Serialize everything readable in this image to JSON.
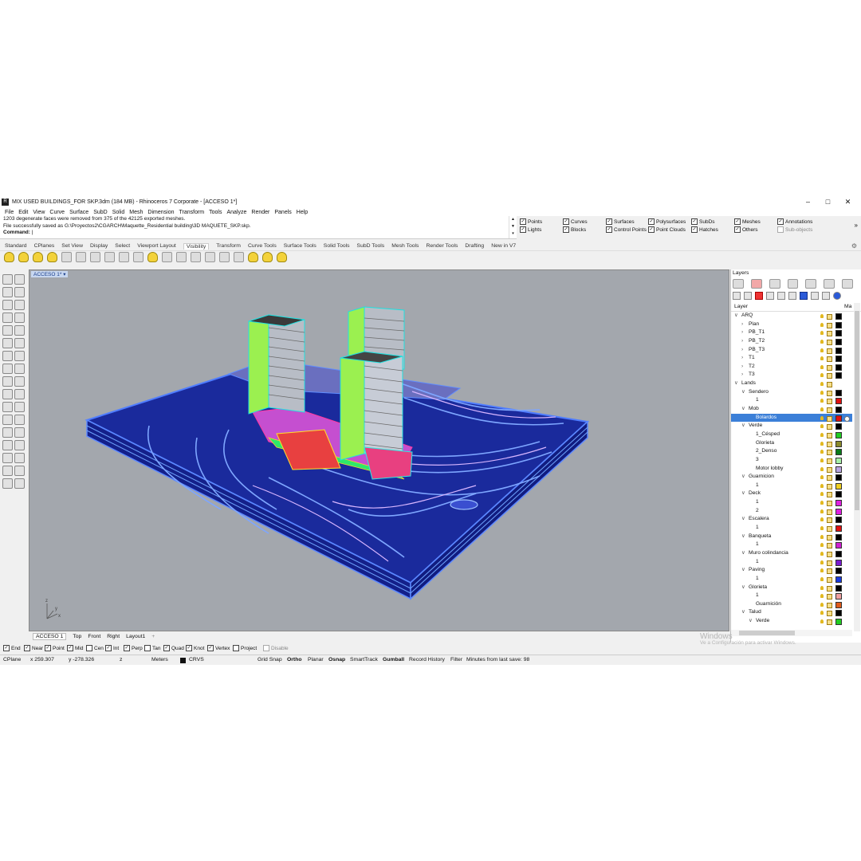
{
  "window": {
    "title": "MIX USED BUILDINGS_FOR SKP.3dm (184 MB) - Rhinoceros 7 Corporate - [ACCESO 1*]",
    "controls": [
      "–",
      "□",
      "✕"
    ]
  },
  "menu": [
    "File",
    "Edit",
    "View",
    "Curve",
    "Surface",
    "SubD",
    "Solid",
    "Mesh",
    "Dimension",
    "Transform",
    "Tools",
    "Analyze",
    "Render",
    "Panels",
    "Help"
  ],
  "command_history": {
    "line1": "1203 degenerate faces were removed from 375 of the 42125 exported meshes.",
    "line2": "File successfully saved as G:\\Proyectos2\\CGARCH\\Maquette_Residential building\\3D MAQUETE_SKP.skp.",
    "prompt": "Command:"
  },
  "selection_filters": {
    "row1": [
      {
        "label": "Points",
        "checked": true
      },
      {
        "label": "Curves",
        "checked": true
      },
      {
        "label": "Surfaces",
        "checked": true
      },
      {
        "label": "Polysurfaces",
        "checked": true
      },
      {
        "label": "SubDs",
        "checked": true
      },
      {
        "label": "Meshes",
        "checked": true
      },
      {
        "label": "Annotations",
        "checked": true
      }
    ],
    "row2": [
      {
        "label": "Lights",
        "checked": true
      },
      {
        "label": "Blocks",
        "checked": true
      },
      {
        "label": "Control Points",
        "checked": true
      },
      {
        "label": "Point Clouds",
        "checked": true
      },
      {
        "label": "Hatches",
        "checked": true
      },
      {
        "label": "Others",
        "checked": true
      },
      {
        "label": "Sub-objects",
        "checked": false
      }
    ]
  },
  "toolbar_tabs": [
    "Standard",
    "CPlanes",
    "Set View",
    "Display",
    "Select",
    "Viewport Layout",
    "Visibility",
    "Transform",
    "Curve Tools",
    "Surface Tools",
    "Solid Tools",
    "SubD Tools",
    "Mesh Tools",
    "Render Tools",
    "Drafting",
    "New in V7"
  ],
  "active_toolbar_tab": "Visibility",
  "viewport": {
    "label": "ACCESO 1*",
    "axis": {
      "x": "x",
      "y": "y",
      "z": "z"
    },
    "colors": {
      "background": "#a3a7ad",
      "terrain": "#1b2a9e",
      "contours": "#6fa4ff"
    }
  },
  "viewport_tabs": [
    "ACCESO 1",
    "Top",
    "Front",
    "Right",
    "Layout1"
  ],
  "osnaps": [
    {
      "label": "End",
      "checked": true
    },
    {
      "label": "Near",
      "checked": true
    },
    {
      "label": "Point",
      "checked": true
    },
    {
      "label": "Mid",
      "checked": true
    },
    {
      "label": "Cen",
      "checked": false
    },
    {
      "label": "Int",
      "checked": true
    },
    {
      "label": "Perp",
      "checked": true
    },
    {
      "label": "Tan",
      "checked": false
    },
    {
      "label": "Quad",
      "checked": true
    },
    {
      "label": "Knot",
      "checked": true
    },
    {
      "label": "Vertex",
      "checked": true
    },
    {
      "label": "Project",
      "checked": false
    },
    {
      "label": "Disable",
      "checked": false
    }
  ],
  "status": {
    "cplane": "CPlane",
    "x": "x 259.307",
    "y": "y -278.326",
    "z": "z",
    "units": "Meters",
    "layer": "CRVS",
    "grid_snap": "Grid Snap",
    "ortho": "Ortho",
    "planar": "Planar",
    "osnap": "Osnap",
    "smarttrack": "SmartTrack",
    "gumball": "Gumball",
    "record_history": "Record History",
    "filter": "Filter",
    "save_info": "Minutes from last save: 98"
  },
  "layers_panel": {
    "title": "Layers",
    "col_layer": "Layer",
    "col_mat": "Ma",
    "rows": [
      {
        "name": "ARQ",
        "level": 0,
        "exp": "v",
        "color": "#000000"
      },
      {
        "name": "Plan",
        "level": 1,
        "exp": ">",
        "color": "#000000"
      },
      {
        "name": "PB_T1",
        "level": 1,
        "exp": ">",
        "color": "#000000"
      },
      {
        "name": "PB_T2",
        "level": 1,
        "exp": ">",
        "color": "#000000"
      },
      {
        "name": "PB_T3",
        "level": 1,
        "exp": ">",
        "color": "#000000"
      },
      {
        "name": "T1",
        "level": 1,
        "exp": ">",
        "color": "#000000"
      },
      {
        "name": "T2",
        "level": 1,
        "exp": ">",
        "color": "#000000"
      },
      {
        "name": "T3",
        "level": 1,
        "exp": ">",
        "color": "#000000"
      },
      {
        "name": "Lands",
        "level": 0,
        "exp": "v",
        "color": ""
      },
      {
        "name": "Sendero",
        "level": 1,
        "exp": "v",
        "color": "#000000"
      },
      {
        "name": "1",
        "level": 2,
        "exp": "",
        "color": "#e01010"
      },
      {
        "name": "Mob",
        "level": 1,
        "exp": "v",
        "color": "#000000"
      },
      {
        "name": "Bolardos",
        "level": 2,
        "exp": "",
        "color": "#e01010",
        "selected": true
      },
      {
        "name": "Verde",
        "level": 1,
        "exp": "v",
        "color": "#000000"
      },
      {
        "name": "1_Césped",
        "level": 2,
        "exp": "",
        "color": "#22cc22"
      },
      {
        "name": "Glorieta",
        "level": 2,
        "exp": "",
        "color": "#8a8a2a"
      },
      {
        "name": "2_Denso",
        "level": 2,
        "exp": "",
        "color": "#0a7a1a"
      },
      {
        "name": "3",
        "level": 2,
        "exp": "",
        "color": "#a6f0a6"
      },
      {
        "name": "Motor lobby",
        "level": 2,
        "exp": "",
        "color": "#b9a4e0"
      },
      {
        "name": "Guarnicion",
        "level": 1,
        "exp": "v",
        "color": "#000000"
      },
      {
        "name": "1",
        "level": 2,
        "exp": "",
        "color": "#f0d020"
      },
      {
        "name": "Deck",
        "level": 1,
        "exp": "v",
        "color": "#000000"
      },
      {
        "name": "1",
        "level": 2,
        "exp": "",
        "color": "#e020e0"
      },
      {
        "name": "2",
        "level": 2,
        "exp": "",
        "color": "#e020e0"
      },
      {
        "name": "Escalera",
        "level": 1,
        "exp": "v",
        "color": "#000000"
      },
      {
        "name": "1",
        "level": 2,
        "exp": "",
        "color": "#e01010"
      },
      {
        "name": "Banqueta",
        "level": 1,
        "exp": "v",
        "color": "#000000"
      },
      {
        "name": "1",
        "level": 2,
        "exp": "",
        "color": "#d020d0"
      },
      {
        "name": "Muro colindancia",
        "level": 1,
        "exp": "v",
        "color": "#000000"
      },
      {
        "name": "1",
        "level": 2,
        "exp": "",
        "color": "#7a1ad0"
      },
      {
        "name": "Paving",
        "level": 1,
        "exp": "v",
        "color": "#000000"
      },
      {
        "name": "1",
        "level": 2,
        "exp": "",
        "color": "#1a3ae0"
      },
      {
        "name": "Glorieta",
        "level": 1,
        "exp": "v",
        "color": "#000000"
      },
      {
        "name": "1",
        "level": 2,
        "exp": "",
        "color": "#f0a0a0"
      },
      {
        "name": "Guarnición",
        "level": 2,
        "exp": "",
        "color": "#e05a1a"
      },
      {
        "name": "Talud",
        "level": 1,
        "exp": "v",
        "color": "#000000"
      },
      {
        "name": "Verde",
        "level": 2,
        "exp": "v",
        "color": "#22cc22"
      }
    ]
  },
  "watermark": {
    "line1": "Windows",
    "line2": "Ve a Configuración para activar Windows."
  }
}
